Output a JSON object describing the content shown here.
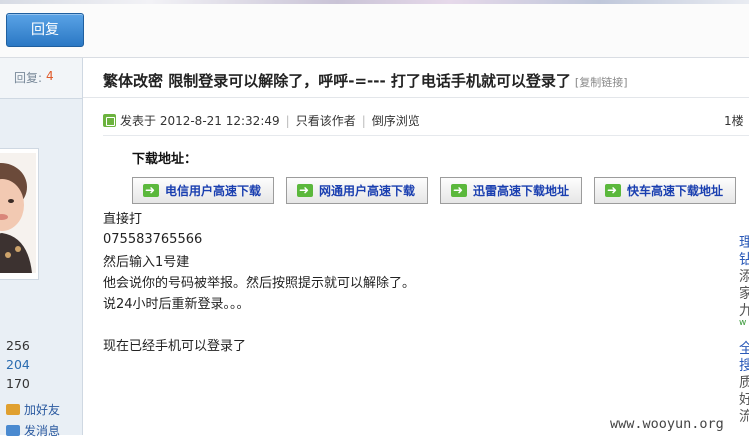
{
  "toolbar": {
    "reply_label": "回复"
  },
  "sidebar": {
    "reply_label": "回复:",
    "reply_count": "4",
    "stats": [
      "256",
      "204",
      "170"
    ],
    "links": [
      {
        "label": "加好友",
        "icon": "add-friend-icon"
      },
      {
        "label": "发消息",
        "icon": "message-icon"
      }
    ]
  },
  "post": {
    "title": "繁体改密 限制登录可以解除了，呼呼-=--- 打了电话手机就可以登录了",
    "copy_link": "[复制链接]",
    "posted_at": "发表于 2012-8-21 12:32:49",
    "only_author": "只看该作者",
    "reverse_order": "倒序浏览",
    "floor": "1楼",
    "download_title": "下载地址：",
    "download_buttons": [
      "电信用户高速下载",
      "网通用户高速下载",
      "迅雷高速下载地址",
      "快车高速下载地址"
    ],
    "lines": [
      "直接打",
      "075583765566",
      "然后输入1号建",
      "他会说你的号码被举报。然后按照提示就可以解除了。",
      "说24小时后重新登录。。。",
      "现在已经手机可以登录了"
    ]
  },
  "right_edge": {
    "chars": [
      "理",
      "钻",
      "添",
      "家",
      "九",
      "w",
      "全",
      "搜",
      "质",
      "好",
      "流"
    ]
  },
  "watermark": "www.wooyun.org"
}
